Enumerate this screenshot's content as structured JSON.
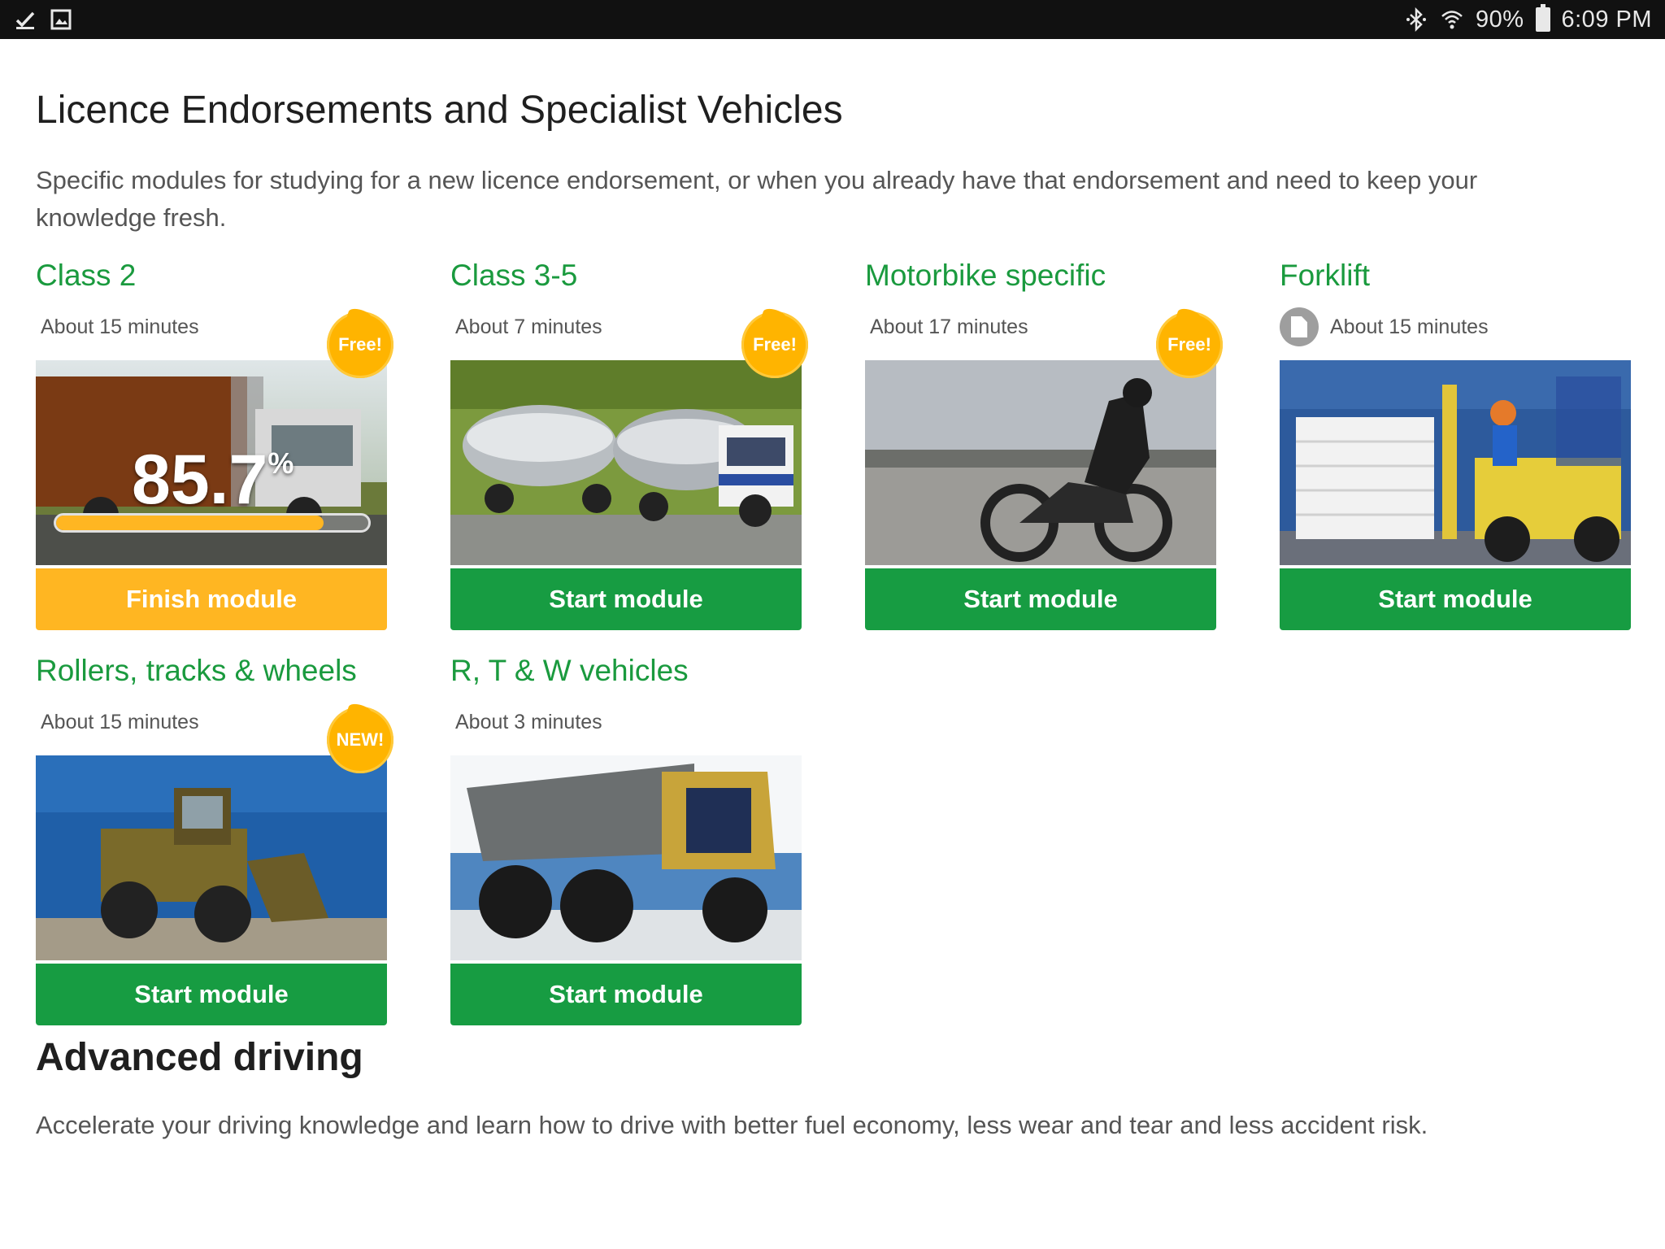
{
  "statusbar": {
    "battery": "90%",
    "time": "6:09 PM",
    "left_icons": [
      "check-icon",
      "image-icon"
    ],
    "right_icons": [
      "bluetooth-icon",
      "wifi-icon",
      "battery-icon"
    ]
  },
  "section1": {
    "title": "Licence Endorsements and Specialist Vehicles",
    "description": "Specific modules for studying for a new licence endorsement, or when you already have that endorsement and need to keep your knowledge fresh."
  },
  "modules": [
    {
      "title": "Class 2",
      "duration": "About 15 minutes",
      "badge": "Free!",
      "button": "Finish module",
      "progress_label": "85.7",
      "progress_unit": "%",
      "progress": 0.857,
      "image": "truck"
    },
    {
      "title": "Class 3-5",
      "duration": "About 7 minutes",
      "badge": "Free!",
      "button": "Start module",
      "image": "tanker"
    },
    {
      "title": "Motorbike specific",
      "duration": "About 17 minutes",
      "badge": "Free!",
      "button": "Start module",
      "image": "motorbike"
    },
    {
      "title": "Forklift",
      "duration": "About 15 minutes",
      "badge": "",
      "button": "Start module",
      "image": "forklift"
    },
    {
      "title": "Rollers, tracks & wheels",
      "duration": "About 15 minutes",
      "badge": "NEW!",
      "button": "Start module",
      "image": "loader"
    },
    {
      "title": "R, T & W vehicles",
      "duration": "About 3 minutes",
      "badge": "",
      "button": "Start module",
      "image": "dumptruck"
    }
  ],
  "section2": {
    "title": "Advanced driving",
    "description": "Accelerate your driving knowledge and learn how to drive with better fuel economy, less wear and tear and less accident risk."
  },
  "colors": {
    "accent_green": "#1a9a3e",
    "button_green": "#179c42",
    "finish_orange": "#ffb622",
    "badge_orange": "#ffb400"
  }
}
